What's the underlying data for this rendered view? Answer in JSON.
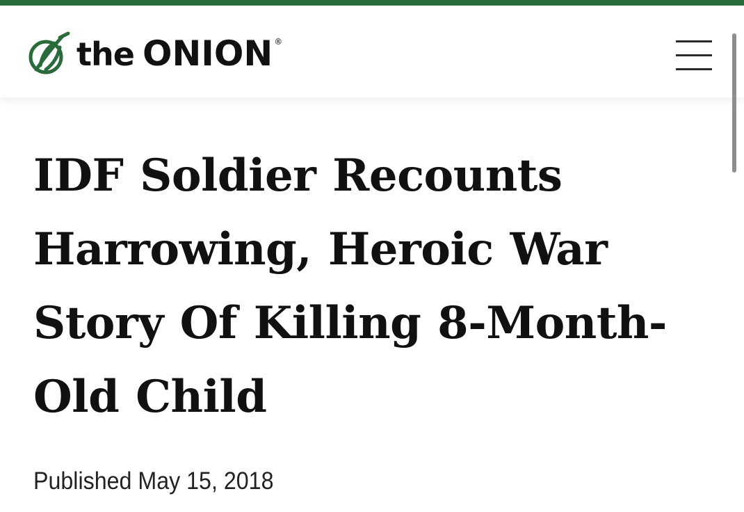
{
  "header": {
    "logo": {
      "the": "the",
      "onion": "ONION",
      "registered": "®",
      "icon": "onion-icon",
      "accent_color": "#2a6b3b"
    },
    "menu_icon": "hamburger-menu-icon"
  },
  "article": {
    "headline": "IDF Soldier Recounts Harrowing, Heroic War Story Of Killing 8-Month-Old Child",
    "published": "Published May 15, 2018"
  }
}
